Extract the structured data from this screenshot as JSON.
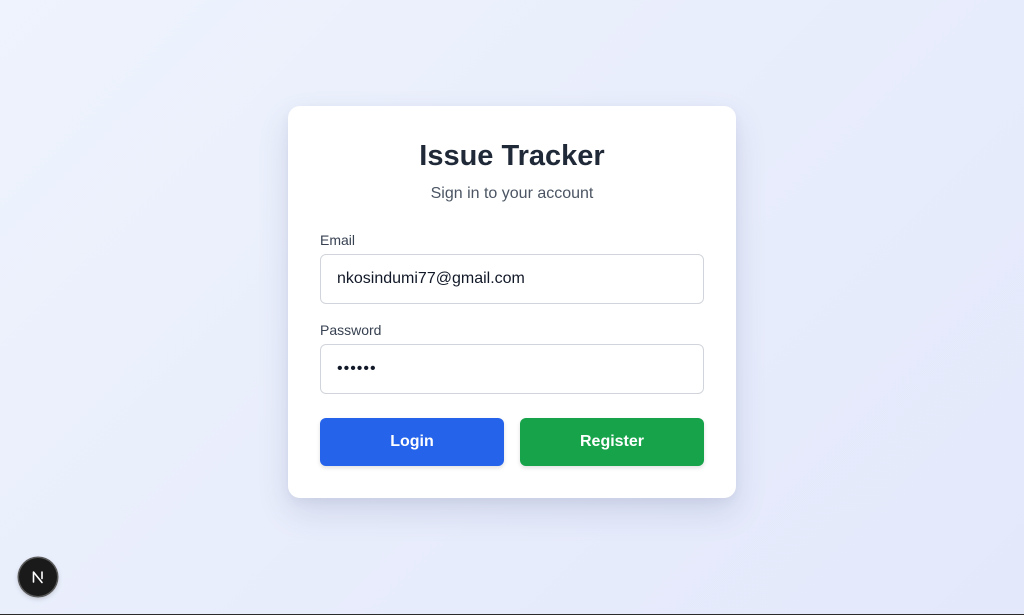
{
  "login": {
    "title": "Issue Tracker",
    "subtitle": "Sign in to your account",
    "email_label": "Email",
    "email_value": "nkosindumi77@gmail.com",
    "password_label": "Password",
    "password_value": "••••••",
    "login_label": "Login",
    "register_label": "Register"
  },
  "colors": {
    "login_button": "#2563eb",
    "register_button": "#16a34a",
    "title_text": "#1f2937"
  },
  "icons": {
    "dev_badge": "next-logo-icon"
  }
}
